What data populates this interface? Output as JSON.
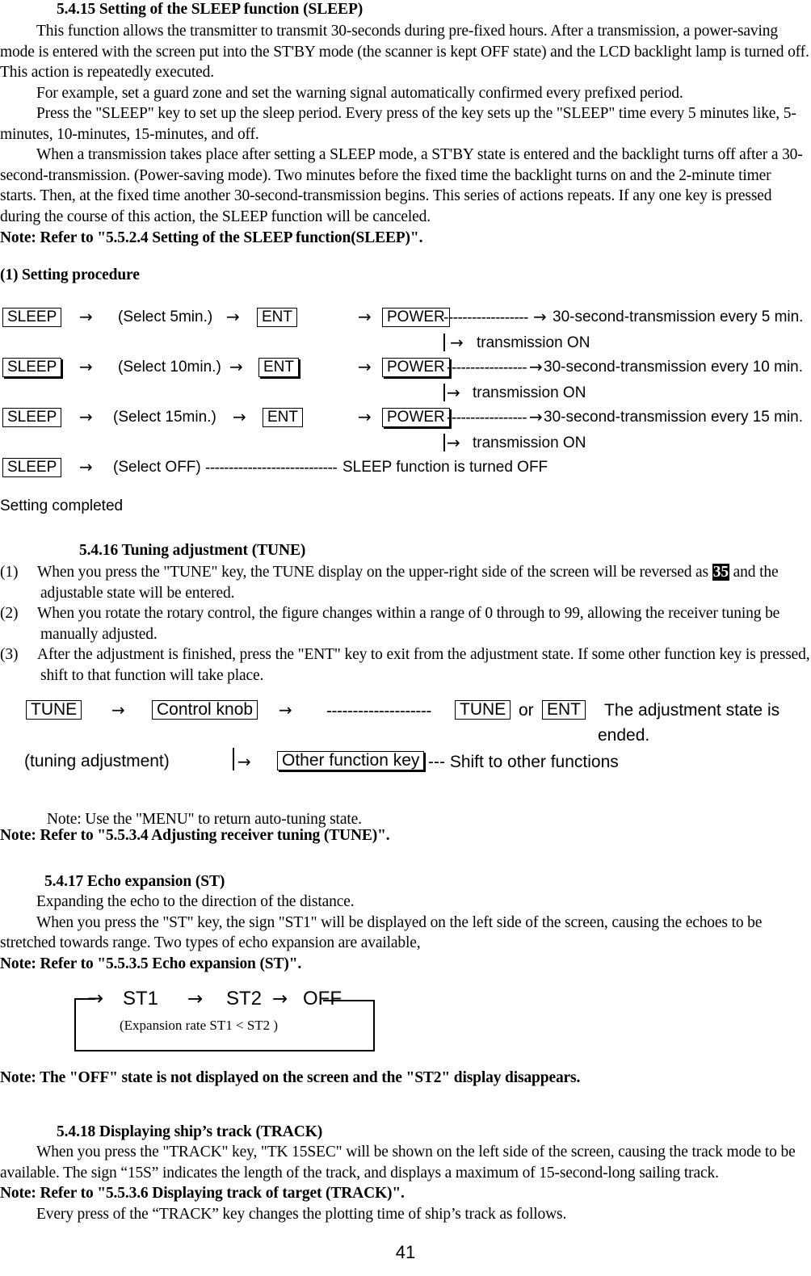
{
  "page_number": "41",
  "sections": {
    "sleep": {
      "heading": "5.4.15 Setting of the SLEEP function (SLEEP)",
      "paragraphs": [
        "This function allows the transmitter to transmit 30-seconds during pre-fixed hours.  After a transmission, a power-saving mode is entered with the screen put into the ST'BY mode (the scanner is kept OFF state) and the LCD backlight lamp is turned off.  This action is repeatedly executed.",
        "For example, set a guard zone and set the warning signal automatically confirmed every prefixed period.",
        "Press the \"SLEEP\" key to set up the sleep period. Every press of the key sets up the \"SLEEP\" time every 5 minutes like, 5-minutes, 10-minutes, 15-minutes, and off.",
        " When a transmission takes place after setting a SLEEP mode, a ST'BY state is entered and the backlight turns off after a 30-second-transmission.  (Power-saving mode).  Two minutes before the fixed time the backlight turns on and the 2-minute timer starts.  Then, at the fixed time another 30-second-transmission begins.  This series of actions repeats.  If any one key is pressed during the course of this action, the SLEEP function will be canceled."
      ],
      "note": "Note: Refer to \"5.5.2.4 Setting of the SLEEP function(SLEEP)\".",
      "procedure_label": "(1)  Setting procedure",
      "rows": [
        {
          "key": "SLEEP",
          "arrow1": "→",
          "select": "(Select 5min.)",
          "arrow2": "→",
          "ent": "ENT",
          "arrow3": "→",
          "power": "POWER",
          "dashes": "------------------",
          "arrow4": "→",
          "result": "30-second-transmission every 5 min.",
          "sub_arrow": "→",
          "sub_result": "transmission ON"
        },
        {
          "key": "SLEEP",
          "arrow1": "→",
          "select": "(Select 10min.)",
          "arrow2": "→",
          "ent": "ENT",
          "arrow3": "→",
          "power": "POWER",
          "dashes": "-----------------",
          "arrow4": "→",
          "result": "30-second-transmission every 10 min.",
          "sub_arrow": "→",
          "sub_result": "transmission ON"
        },
        {
          "key": "SLEEP",
          "arrow1": "→",
          "select": "(Select 15min.)",
          "arrow2": "→",
          "ent": "ENT",
          "arrow3": "→",
          "power": "POWER",
          "dashes": "-----------------",
          "arrow4": "→",
          "result": "30-second-transmission every 15 min.",
          "sub_arrow": "→",
          "sub_result": "transmission ON"
        }
      ],
      "off_row": {
        "key": "SLEEP",
        "arrow1": "→",
        "select": "(Select OFF)",
        "dashes": "----------------------------",
        "result": "SLEEP function is turned OFF"
      },
      "completed": "Setting completed"
    },
    "tune": {
      "heading": "5.4.16 Tuning adjustment (TUNE)",
      "items": [
        {
          "label": "(1)",
          "text_before": "When you press the \"TUNE\" key, the TUNE display on the upper-right side of the screen will be reversed as ",
          "inverted": "35",
          "text_after": " and the adjustable state will be entered."
        },
        {
          "label": "(2)",
          "text_before": "When you rotate the rotary control, the figure changes within a range of 0 through to 99, allowing the receiver tuning be manually adjusted.",
          "inverted": "",
          "text_after": ""
        },
        {
          "label": "(3)",
          "text_before": "After the adjustment is finished, press the \"ENT\" key to exit from the adjustment state.  If some other function key is pressed, shift to that function will take place.",
          "inverted": "",
          "text_after": ""
        }
      ],
      "diagram": {
        "tune_key": "TUNE",
        "arrow1": "→",
        "knob_key": "Control knob",
        "arrow2": "→",
        "dashes": "--------------------",
        "tune_key2": "TUNE",
        "or": "or",
        "ent_key": "ENT",
        "ended_line1": "The adjustment state is",
        "ended_line2": "ended.",
        "tuning_label": "(tuning adjustment)",
        "arrow3": "→",
        "other_key": "Other function key",
        "shift_text": "--- Shift to other functions"
      },
      "note_menu": "Note: Use the \"MENU\" to return auto-tuning state.",
      "note_refer": "Note: Refer to \"5.5.3.4 Adjusting receiver tuning (TUNE)\"."
    },
    "st": {
      "heading": "5.4.17 Echo expansion (ST)",
      "paragraphs": [
        "Expanding the echo to the direction of the distance.",
        "When you press the \"ST\" key, the sign \"ST1\" will be displayed on the left side of the screen, causing the echoes to be stretched towards range.  Two types of echo expansion are available,"
      ],
      "note_refer": "Note: Refer to \"5.5.3.5 Echo expansion (ST)\".",
      "loop": {
        "entry_arrow": "→",
        "st1": "ST1",
        "arrow1": "→",
        "st2": "ST2",
        "arrow2": "→",
        "off": "OFF",
        "caption": "(Expansion rate ST1 < ST2 )"
      },
      "note_off": "Note: The \"OFF\" state is not displayed on the screen and the \"ST2\" display disappears."
    },
    "track": {
      "heading": "5.4.18 Displaying ship’s track (TRACK)",
      "paragraphs": [
        "When you press the \"TRACK\" key, \"TK 15SEC\" will be shown on the left side of the screen, causing the track mode to be available.  The sign “15S” indicates the length of the track, and displays a maximum of 15-second-long sailing track."
      ],
      "note_refer": "Note: Refer to \"5.5.3.6 Displaying track of target (TRACK)\".",
      "last_line": "Every press of the “TRACK” key changes the plotting time of ship’s track as follows."
    }
  }
}
